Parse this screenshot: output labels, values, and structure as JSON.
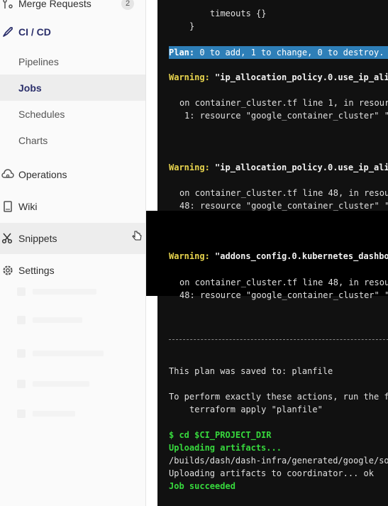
{
  "sidebar": {
    "merge_requests": {
      "label": "Merge Requests",
      "count": "2"
    },
    "ci_cd": {
      "label": "CI / CD"
    },
    "sub_items": [
      {
        "label": "Pipelines",
        "active": false
      },
      {
        "label": "Jobs",
        "active": true
      },
      {
        "label": "Schedules",
        "active": false
      },
      {
        "label": "Charts",
        "active": false
      }
    ],
    "operations": {
      "label": "Operations"
    },
    "wiki": {
      "label": "Wiki"
    },
    "snippets": {
      "label": "Snippets"
    },
    "settings": {
      "label": "Settings"
    }
  },
  "terminal": {
    "lines": {
      "timeouts": "timeouts {}",
      "brace": "}",
      "plan_key": "Plan:",
      "plan_value": " 0 to add, 1 to change, 0 to destroy.",
      "warn1_key": "Warning:",
      "warn1_value": " \"ip_allocation_policy.0.use_ip_ali",
      "warn1_loc": "on container_cluster.tf line 1, in resour",
      "warn1_res": "1: resource \"google_container_cluster\" \"",
      "warn2_key": "Warning:",
      "warn2_value": " \"ip_allocation_policy.0.use_ip_ali",
      "warn2_loc": "on container_cluster.tf line 48, in resou",
      "warn2_res": "48: resource \"google_container_cluster\" \"",
      "warn3_key": "Warning:",
      "warn3_value": " \"addons_config.0.kubernetes_dashbo",
      "warn3_loc": "on container_cluster.tf line 48, in resou",
      "warn3_res": "48: resource \"google_container_cluster\" \"",
      "saved": "This plan was saved to: planfile",
      "perform": "To perform exactly these actions, run the f",
      "apply": "terraform apply \"planfile\"",
      "cd": "$ cd $CI_PROJECT_DIR",
      "uploading": "Uploading artifacts...",
      "path": "/builds/dash/dash-infra/generated/google/so",
      "coordinator": "Uploading artifacts to coordinator... ok",
      "succeeded": "Job succeeded"
    }
  },
  "colors": {
    "plan_highlight": "#2e7fb8",
    "warning": "#e8d44d",
    "success": "#37d93d",
    "terminal_bg": "#111111",
    "nav_active": "#2b2f6b"
  }
}
